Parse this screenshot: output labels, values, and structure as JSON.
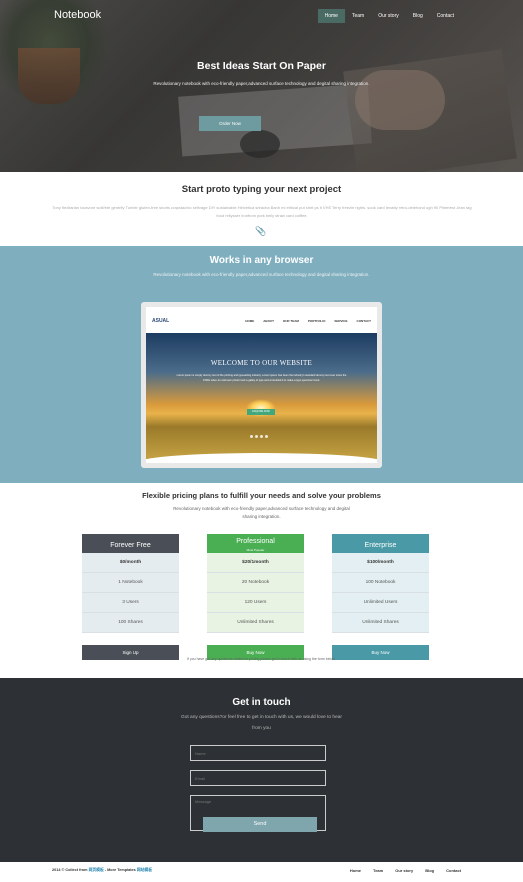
{
  "header": {
    "brand": "Notebook",
    "nav": [
      "Home",
      "Team",
      "Our story",
      "Blog",
      "Contact"
    ],
    "active_nav": "Home"
  },
  "hero": {
    "title": "Best Ideas Start On Paper",
    "subtitle": "Revolutionary notebook with eco-friendly paper,advanced surface technology and degital sharing integration.",
    "button": "Order Now"
  },
  "proto": {
    "title": "Start proto typing your next project",
    "text": "Tony flexitarian locavore wolf/ete gentrify Tumblr gluten-free shorts crapstachio selfvage DIY sustainable Helvetica sriracha Banh mi ethical put shirt ps it VHS Terry freezie rights. sook card Ienatty retro-delehond ugh 90 Pinterest Jean tag food rellysser ironfrom pork belly straw card coiffee."
  },
  "works": {
    "title": "Works in any browser",
    "subtitle": "Revolutionary notebook with eco-friendly paper,advanced surface technology and degital sharing integration.",
    "mock": {
      "logo": "ASUAL",
      "menu": [
        "HOME",
        "ABOUT",
        "OUR TEAM",
        "PORTFOLIO",
        "SERVICE",
        "CONTACT"
      ],
      "title": "WELCOME TO OUR WEBSITE",
      "text": "Lorem ipsum is simply dummy text of the printing and typesetting industry. Lorem ipsum has been the industry's standard dummy text ever since the 1500s when an unknown printer took a galley of type and scrambled it to make a type specimen book.",
      "button": "ENQUIRE NOW"
    }
  },
  "pricing": {
    "title": "Flexible pricing plans to fulfill your needs and solve your problems",
    "subtitle": "Revolutionary notebook with eco-friendly paper,advanced surface technology and degital sharing integration.",
    "plans": [
      {
        "name": "Forever Free",
        "price": "$0/month",
        "items": [
          "1 Notebook",
          "3 Users",
          "100 Shares"
        ],
        "button": "Sign Up"
      },
      {
        "name": "Professional",
        "popular": "Most Popular",
        "price": "$20/1month",
        "items": [
          "20 Notebook",
          "120 Users",
          "Unlimited Shares"
        ],
        "button": "Buy Now"
      },
      {
        "name": "Enterprise",
        "price": "$100/month",
        "items": [
          "100 Notebook",
          "Unlimited Users",
          "Unlimited Shares"
        ],
        "button": "Buy Now"
      }
    ],
    "note": "If you have got any questions related to pricing please get in touch with us using the form below"
  },
  "contact": {
    "title": "Get in touch",
    "subtitle": "Got any questions?or feel free to get in touch with us, we would love to hear from you",
    "fields": [
      "Name",
      "Email",
      "Message"
    ],
    "button": "Send"
  },
  "footer": {
    "copyright": "2014 © Collect from",
    "copyright_link": "网页模板",
    "more": "- More Templates",
    "more_link": "网站模板",
    "nav": [
      "Home",
      "Team",
      "Our story",
      "Blog",
      "Contact"
    ]
  },
  "colors": {
    "works_bg": "#7fafbf",
    "contact_bg": "#2d3034",
    "free": "#4a4f57",
    "professional": "#4aae53",
    "enterprise": "#4a99a6"
  }
}
